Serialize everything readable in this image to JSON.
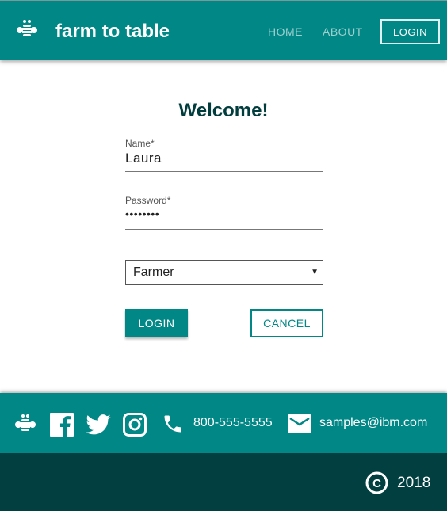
{
  "header": {
    "brand": "farm to table",
    "nav": [
      "HOME",
      "ABOUT"
    ],
    "login": "LOGIN"
  },
  "form": {
    "title": "Welcome!",
    "name_label": "Name*",
    "name_value": "Laura",
    "password_label": "Password*",
    "password_value": "••••••••",
    "role_selected": "Farmer",
    "login_button": "LOGIN",
    "cancel_button": "CANCEL"
  },
  "footer": {
    "phone": "800-555-5555",
    "email": "samples@ibm.com",
    "year": "2018"
  },
  "colors": {
    "primary": "#008786",
    "dark": "#013f40"
  }
}
